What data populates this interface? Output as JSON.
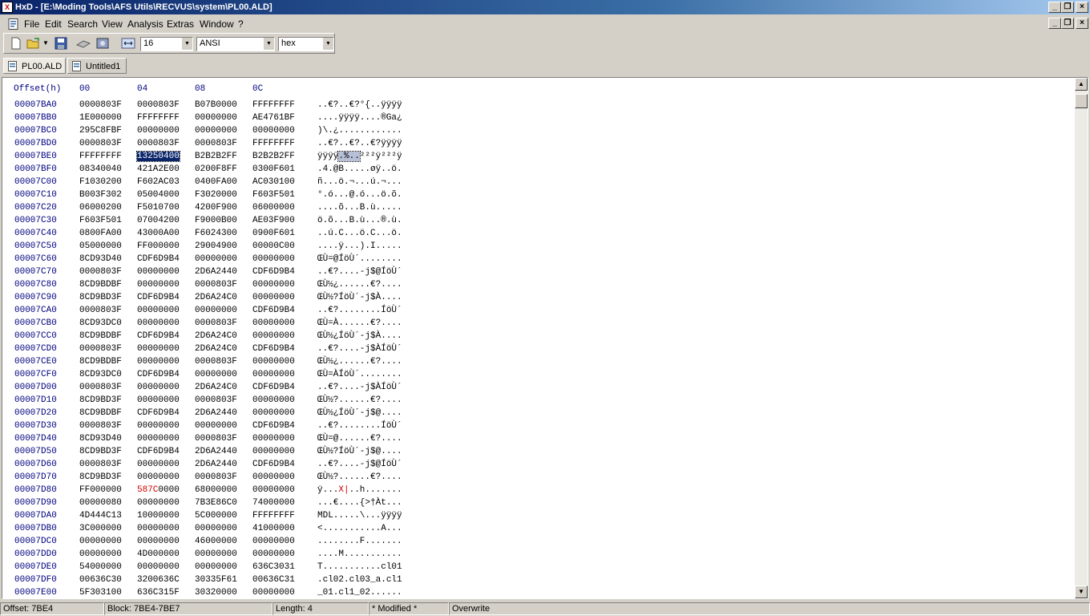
{
  "window": {
    "title": "HxD - [E:\\Moding Tools\\AFS Utils\\RECVUS\\system\\PL00.ALD]",
    "app_icon": "hxd-app-icon"
  },
  "menu": [
    "File",
    "Edit",
    "Search",
    "View",
    "Analysis",
    "Extras",
    "Window",
    "?"
  ],
  "toolbar": {
    "bytes_per_row": "16",
    "charset": "ANSI",
    "offset_base": "hex"
  },
  "tabs": [
    {
      "label": "PL00.ALD",
      "active": true
    },
    {
      "label": "Untitled1",
      "active": false
    }
  ],
  "hex_view": {
    "header": {
      "offset": "Offset(h)",
      "cols": [
        "00",
        "04",
        "08",
        "0C"
      ]
    },
    "rows": [
      {
        "off": "00007BA0",
        "h": [
          "0000803F",
          "0000803F",
          "B07B0000",
          "FFFFFFFF"
        ],
        "a": "..€?..€?°{..ÿÿÿÿ"
      },
      {
        "off": "00007BB0",
        "h": [
          "1E000000",
          "FFFFFFFF",
          "00000000",
          "AE4761BF"
        ],
        "a": "....ÿÿÿÿ....®Ga¿"
      },
      {
        "off": "00007BC0",
        "h": [
          "295C8FBF",
          "00000000",
          "00000000",
          "00000000"
        ],
        "a": ")\\.¿............"
      },
      {
        "off": "00007BD0",
        "h": [
          "0000803F",
          "0000803F",
          "0000803F",
          "FFFFFFFF"
        ],
        "a": "..€?..€?..€?ÿÿÿÿ"
      },
      {
        "off": "00007BE0",
        "h": [
          "FFFFFFFF",
          "13250400",
          "B2B2B2FF",
          "B2B2B2FF"
        ],
        "a": "ÿÿÿÿ.%..²²²ÿ²²²ÿ"
      },
      {
        "off": "00007BF0",
        "h": [
          "08340040",
          "421A2E00",
          "0200F8FF",
          "0300F601"
        ],
        "a": ".4.@B.....øÿ..ö."
      },
      {
        "off": "00007C00",
        "h": [
          "F1030200",
          "F602AC03",
          "0400FA00",
          "AC030100"
        ],
        "a": "ñ...ö.¬...ú.¬..."
      },
      {
        "off": "00007C10",
        "h": [
          "B003F302",
          "05004000",
          "F3020000",
          "F603F501"
        ],
        "a": "°.ó...@.ó...ö.õ."
      },
      {
        "off": "00007C20",
        "h": [
          "06000200",
          "F5010700",
          "4200F900",
          "06000000"
        ],
        "a": "....õ...B.ù....."
      },
      {
        "off": "00007C30",
        "h": [
          "F603F501",
          "07004200",
          "F9000B00",
          "AE03F900"
        ],
        "a": "ö.õ...B.ù...®.ù."
      },
      {
        "off": "00007C40",
        "h": [
          "0800FA00",
          "43000A00",
          "F6024300",
          "0900F601"
        ],
        "a": "..ú.C...ö.C...ö."
      },
      {
        "off": "00007C50",
        "h": [
          "05000000",
          "FF000000",
          "29004900",
          "00000C00"
        ],
        "a": "....ÿ...).I....."
      },
      {
        "off": "00007C60",
        "h": [
          "8CD93D40",
          "CDF6D9B4",
          "00000000",
          "00000000"
        ],
        "a": "ŒÙ=@ÍöÙ´........"
      },
      {
        "off": "00007C70",
        "h": [
          "0000803F",
          "00000000",
          "2D6A2440",
          "CDF6D9B4"
        ],
        "a": "..€?....-j$@ÍöÙ´"
      },
      {
        "off": "00007C80",
        "h": [
          "8CD9BDBF",
          "00000000",
          "0000803F",
          "00000000"
        ],
        "a": "ŒÙ½¿......€?...."
      },
      {
        "off": "00007C90",
        "h": [
          "8CD9BD3F",
          "CDF6D9B4",
          "2D6A24C0",
          "00000000"
        ],
        "a": "ŒÙ½?ÍöÙ´-j$À...."
      },
      {
        "off": "00007CA0",
        "h": [
          "0000803F",
          "00000000",
          "00000000",
          "CDF6D9B4"
        ],
        "a": "..€?........ÍöÙ´"
      },
      {
        "off": "00007CB0",
        "h": [
          "8CD93DC0",
          "00000000",
          "0000803F",
          "00000000"
        ],
        "a": "ŒÙ=À......€?...."
      },
      {
        "off": "00007CC0",
        "h": [
          "8CD9BDBF",
          "CDF6D9B4",
          "2D6A24C0",
          "00000000"
        ],
        "a": "ŒÙ½¿ÍöÙ´-j$À...."
      },
      {
        "off": "00007CD0",
        "h": [
          "0000803F",
          "00000000",
          "2D6A24C0",
          "CDF6D9B4"
        ],
        "a": "..€?....-j$ÀÍöÙ´"
      },
      {
        "off": "00007CE0",
        "h": [
          "8CD9BDBF",
          "00000000",
          "0000803F",
          "00000000"
        ],
        "a": "ŒÙ½¿......€?...."
      },
      {
        "off": "00007CF0",
        "h": [
          "8CD93DC0",
          "CDF6D9B4",
          "00000000",
          "00000000"
        ],
        "a": "ŒÙ=ÀÍöÙ´........"
      },
      {
        "off": "00007D00",
        "h": [
          "0000803F",
          "00000000",
          "2D6A24C0",
          "CDF6D9B4"
        ],
        "a": "..€?....-j$ÀÍöÙ´"
      },
      {
        "off": "00007D10",
        "h": [
          "8CD9BD3F",
          "00000000",
          "0000803F",
          "00000000"
        ],
        "a": "ŒÙ½?......€?...."
      },
      {
        "off": "00007D20",
        "h": [
          "8CD9BDBF",
          "CDF6D9B4",
          "2D6A2440",
          "00000000"
        ],
        "a": "ŒÙ½¿ÍöÙ´-j$@...."
      },
      {
        "off": "00007D30",
        "h": [
          "0000803F",
          "00000000",
          "00000000",
          "CDF6D9B4"
        ],
        "a": "..€?........ÍöÙ´"
      },
      {
        "off": "00007D40",
        "h": [
          "8CD93D40",
          "00000000",
          "0000803F",
          "00000000"
        ],
        "a": "ŒÙ=@......€?...."
      },
      {
        "off": "00007D50",
        "h": [
          "8CD9BD3F",
          "CDF6D9B4",
          "2D6A2440",
          "00000000"
        ],
        "a": "ŒÙ½?ÍöÙ´-j$@...."
      },
      {
        "off": "00007D60",
        "h": [
          "0000803F",
          "00000000",
          "2D6A2440",
          "CDF6D9B4"
        ],
        "a": "..€?....-j$@ÍöÙ´"
      },
      {
        "off": "00007D70",
        "h": [
          "8CD9BD3F",
          "00000000",
          "0000803F",
          "00000000"
        ],
        "a": "ŒÙ½?......€?...."
      },
      {
        "off": "00007D80",
        "h": [
          "FF000000",
          "587C0000",
          "68000000",
          "00000000"
        ],
        "a": "ÿ...X|..h......."
      },
      {
        "off": "00007D90",
        "h": [
          "00000080",
          "00000000",
          "7B3E86C0",
          "74000000"
        ],
        "a": "...€....{>†Àt..."
      },
      {
        "off": "00007DA0",
        "h": [
          "4D444C13",
          "10000000",
          "5C000000",
          "FFFFFFFF"
        ],
        "a": "MDL.....\\...ÿÿÿÿ"
      },
      {
        "off": "00007DB0",
        "h": [
          "3C000000",
          "00000000",
          "00000000",
          "41000000"
        ],
        "a": "<...........A..."
      },
      {
        "off": "00007DC0",
        "h": [
          "00000000",
          "00000000",
          "46000000",
          "00000000"
        ],
        "a": "........F......."
      },
      {
        "off": "00007DD0",
        "h": [
          "00000000",
          "4D000000",
          "00000000",
          "00000000"
        ],
        "a": "....M..........."
      },
      {
        "off": "00007DE0",
        "h": [
          "54000000",
          "00000000",
          "00000000",
          "636C3031"
        ],
        "a": "T...........cl01"
      },
      {
        "off": "00007DF0",
        "h": [
          "00636C30",
          "3200636C",
          "30335F61",
          "00636C31"
        ],
        "a": ".cl02.cl03_a.cl1"
      },
      {
        "off": "00007E00",
        "h": [
          "5F303100",
          "636C315F",
          "30320000",
          "00000000"
        ],
        "a": "_01.cl1_02......"
      }
    ]
  },
  "status": {
    "offset": "Offset: 7BE4",
    "block": "Block: 7BE4-7BE7",
    "length": "Length: 4",
    "modified": "* Modified *",
    "mode": "Overwrite"
  },
  "colors": {
    "offset_text": "#000080",
    "selection": "#0a246a",
    "modified_text": "#d00000"
  }
}
